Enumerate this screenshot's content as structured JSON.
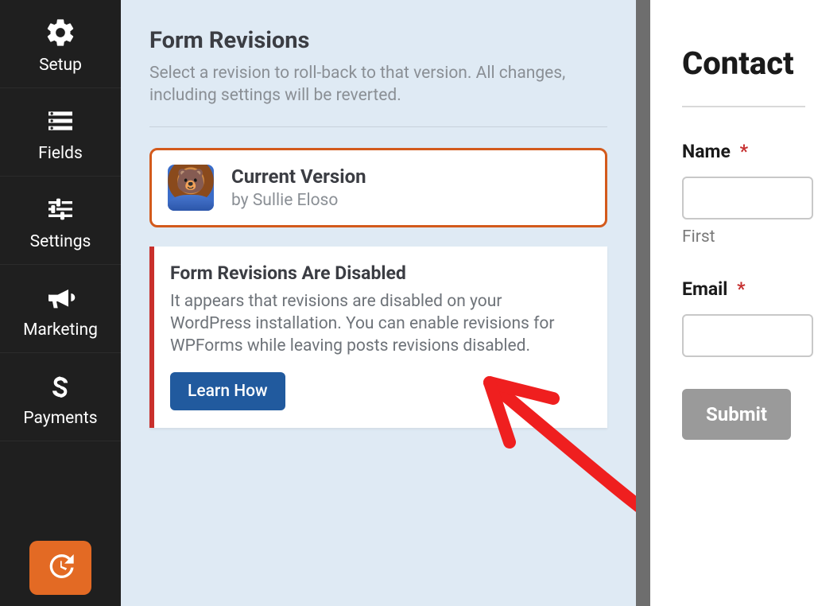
{
  "sidebar": {
    "items": [
      {
        "label": "Setup"
      },
      {
        "label": "Fields"
      },
      {
        "label": "Settings"
      },
      {
        "label": "Marketing"
      },
      {
        "label": "Payments"
      }
    ]
  },
  "panel": {
    "title": "Form Revisions",
    "subtitle": "Select a revision to roll-back to that version. All changes, including settings will be reverted.",
    "current": {
      "title": "Current Version",
      "byline": "by Sullie Eloso"
    },
    "notice": {
      "title": "Form Revisions Are Disabled",
      "body": "It appears that revisions are disabled on your WordPress installation. You can enable revisions for WPForms while leaving posts revisions disabled.",
      "button": "Learn How"
    }
  },
  "preview": {
    "heading": "Contact",
    "fields": [
      {
        "label": "Name",
        "required": true,
        "sublabel": "First"
      },
      {
        "label": "Email",
        "required": true
      }
    ],
    "submit": "Submit",
    "required_mark": "*"
  }
}
